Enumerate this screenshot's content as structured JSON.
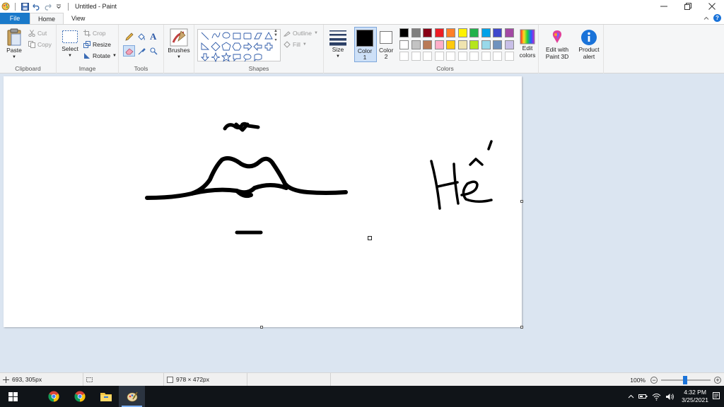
{
  "window": {
    "title": "Untitled - Paint"
  },
  "tabs": {
    "file": "File",
    "home": "Home",
    "view": "View"
  },
  "ribbon": {
    "clipboard": {
      "label": "Clipboard",
      "paste": "Paste",
      "cut": "Cut",
      "copy": "Copy"
    },
    "image": {
      "label": "Image",
      "select": "Select",
      "crop": "Crop",
      "resize": "Resize",
      "rotate": "Rotate"
    },
    "tools": {
      "label": "Tools"
    },
    "brushes": {
      "label": "Brushes"
    },
    "shapes": {
      "label": "Shapes",
      "outline": "Outline",
      "fill": "Fill"
    },
    "size": {
      "label": "Size"
    },
    "colors": {
      "label": "Colors",
      "color1": "Color",
      "color1_num": "1",
      "color2": "Color",
      "color2_num": "2",
      "edit_colors_1": "Edit",
      "edit_colors_2": "colors",
      "palette_row1": [
        "#000000",
        "#7f7f7f",
        "#880015",
        "#ed1c24",
        "#ff7f27",
        "#fff200",
        "#22b14c",
        "#00a2e8",
        "#3f48cc",
        "#a349a4"
      ],
      "palette_row2": [
        "#ffffff",
        "#c3c3c3",
        "#b97a57",
        "#ffaec9",
        "#ffc90e",
        "#efe4b0",
        "#b5e61d",
        "#99d9ea",
        "#7092be",
        "#c8bfe7"
      ],
      "color1_value": "#000000",
      "color2_value": "#ffffff"
    },
    "paint3d": {
      "line1": "Edit with",
      "line2": "Paint 3D"
    },
    "product_alert": {
      "line1": "Product",
      "line2": "alert"
    }
  },
  "status": {
    "cursor_pos": "693, 305px",
    "canvas_size": "978 × 472px",
    "zoom": "100%"
  },
  "taskbar": {
    "time": "4:32 PM",
    "date": "3/25/2021"
  }
}
